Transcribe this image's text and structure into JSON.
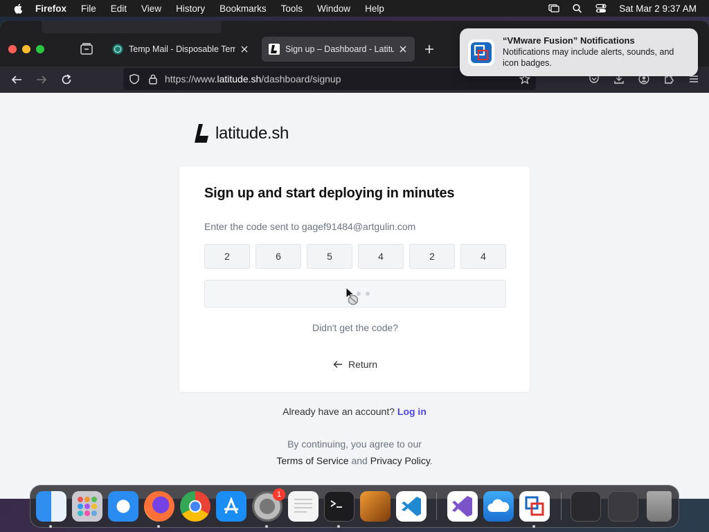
{
  "menubar": {
    "app": "Firefox",
    "items": [
      "File",
      "Edit",
      "View",
      "History",
      "Bookmarks",
      "Tools",
      "Window",
      "Help"
    ],
    "clock": "Sat Mar 2  9:37 AM"
  },
  "browser": {
    "tabs": [
      {
        "title": "Temp Mail - Disposable Temporary Email",
        "active": false
      },
      {
        "title": "Sign up – Dashboard - Latitude.sh",
        "active": true
      }
    ],
    "url_prefix": "https://www.",
    "url_domain": "latitude.sh",
    "url_path": "/dashboard/signup"
  },
  "notification": {
    "title": "“VMware Fusion” Notifications",
    "body": "Notifications may include alerts, sounds, and icon badges."
  },
  "page": {
    "brand": "latitude.sh",
    "heading": "Sign up and start deploying in minutes",
    "hint": "Enter the code sent to gagef91484@artgulin.com",
    "code_digits": [
      "2",
      "6",
      "5",
      "4",
      "2",
      "4"
    ],
    "resend_text": "Didn't get the code?",
    "return_label": "Return",
    "already_text": "Already have an account?",
    "login_label": "Log in",
    "terms_line1": "By continuing, you agree to our",
    "terms_of_service": "Terms of Service",
    "and_text": "and",
    "privacy_policy": "Privacy Policy",
    "period": "."
  },
  "dock": {
    "apps": [
      "Finder",
      "Launchpad",
      "Safari",
      "Firefox",
      "Chrome",
      "App Store",
      "System Settings",
      "TextEdit",
      "Terminal",
      "GarageBand",
      "Visual Studio Code",
      "Visual Studio",
      "iCloud",
      "VMware Fusion",
      "Documents",
      "Downloads",
      "Trash"
    ],
    "settings_badge": "1"
  },
  "colors": {
    "link": "#4f46e5",
    "page_bg": "#f3f4f6",
    "tabbar_bg": "#202023"
  }
}
